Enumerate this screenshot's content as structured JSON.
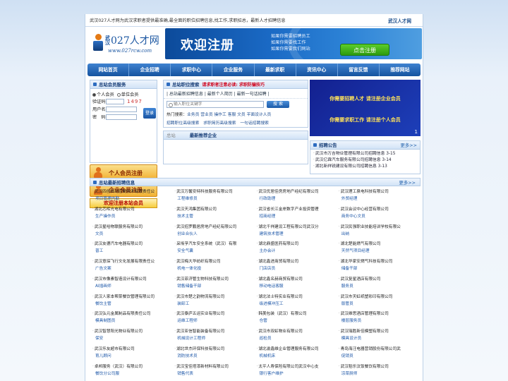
{
  "topbar": {
    "notice": "武汉027人才网为武汉求职者提供最准确,最全面的职位招聘信息,找工作,求职招总，最新人才招聘信息",
    "site_name": "武汉人才网"
  },
  "logo": {
    "city": "武汉",
    "name": "027人才网",
    "url": "www.027rcw.com"
  },
  "banner": {
    "welcome": "欢迎注册",
    "lines": [
      "如果你需要招聘员工",
      "如果你需要找工作",
      "如果你需要我们网站"
    ],
    "button": "点击注册"
  },
  "nav": [
    "网站首页",
    "企业招聘",
    "求职中心",
    "企业服务",
    "最新求职",
    "资讯中心",
    "留言反馈",
    "推荐网站"
  ],
  "login": {
    "title": "总站会员服务",
    "role_personal": "个人会员",
    "role_company": "单位会员",
    "captcha_label": "验证码",
    "captcha_value": "1497",
    "username_label": "用户名",
    "password_label": "密　码",
    "login_button": "登录",
    "personal_register": "个人会员注册",
    "company_register": "企业会员注册",
    "welcome_link": "欢迎注册本站会员"
  },
  "jobsearch": {
    "title": "总站职位搜索",
    "notice": "请求职者注意必读: 求职防骗技巧",
    "tabs": "| 总站最新招聘信息 | 最新个人简历 | 最新一句话招聘 |",
    "placeholder": "输入职位关键字",
    "button": "搜 索",
    "hot_label": "热门搜索：",
    "hot_keywords": "业务员 营业员 操作工 客服 文员 平面设计人员",
    "links": "招聘职位高级搜索　求职简历高级搜索　一句话招聘搜索"
  },
  "recommend": {
    "label1": "总站",
    "title": "最新推荐企业"
  },
  "adbox": {
    "line1": "你需要招聘人才 请注册企业会员",
    "line2": "你需要求职工作 请注册个人会员",
    "page": "1"
  },
  "announcement": {
    "title": "招聘公告",
    "more": "更多>>",
    "items": [
      "武汉市万吉物业管理有限公司招聘信息 3-15",
      "武汉亿霖汽车服务有限公司招聘信息 3-14",
      "湖北新祥锐建设有限公司招聘信息 3-13"
    ]
  },
  "latest": {
    "title": "总站最新招聘信息",
    "more": "更多>>",
    "jobs": [
      {
        "company": "武汉四创自动控制技术有限责任公",
        "position": "项目管理内勤"
      },
      {
        "company": "武汉万馨安特科技服务有限公司",
        "position": "工程维修员"
      },
      {
        "company": "武汉优居佳房房地产经纪有限公司",
        "position": "行政助理"
      },
      {
        "company": "武汉理工泉电科技有限公司",
        "position": "外贸经理"
      },
      {
        "company": "湖北芯晖光电有限公司",
        "position": "生产操作员"
      },
      {
        "company": "武汉天鸿集团有限公司",
        "position": "技术主管"
      },
      {
        "company": "武汉省长江金岸数字产业投资管理",
        "position": "招商经理"
      },
      {
        "company": "武汉会议中心经营有限公司",
        "position": "商务中心文员"
      },
      {
        "company": "武汉星哈物联服务有限公司",
        "position": "文员"
      },
      {
        "company": "武汉招罗鹏居房地产经纪有限公司",
        "position": "创业合伙人"
      },
      {
        "company": "湖北千祥建设工程有限公司武汉分",
        "position": "建筑技术管理"
      },
      {
        "company": "武汉民强职业技能培训学校有限公",
        "position": "出纳"
      },
      {
        "company": "武汉友德汽车电器有限公司",
        "position": "普工"
      },
      {
        "company": "采埃孚汽车安全系统（武汉）有限",
        "position": "安全气囊"
      },
      {
        "company": "湖北鼎盛医药有限公司",
        "position": "主办会计"
      },
      {
        "company": "湖北楚能燃气有限公司",
        "position": "天然气项目经理"
      },
      {
        "company": "武汉意琛飞行文化发展有限责任公",
        "position": "广告文案"
      },
      {
        "company": "武汉梅大华纺织有限公司",
        "position": "机电一体化投"
      },
      {
        "company": "湖北鑫进商贸有限公司",
        "position": "门店店员"
      },
      {
        "company": "湖北华家安燃气科技有限公司",
        "position": "储备干部"
      },
      {
        "company": "武汉市像素智造设计有限公司",
        "position": "AI插画师"
      },
      {
        "company": "武汉菲济管生物科技有限公司",
        "position": "销售储备干部"
      },
      {
        "company": "湖北鑫名赫商贸有限公司",
        "position": "移动电话客服"
      },
      {
        "company": "武汉复星酒店有限公司",
        "position": "服务员"
      },
      {
        "company": "武汉人家本帮菜餐饮管理有限公司",
        "position": "餐饮主管"
      },
      {
        "company": "武汉市楚之韵物流有限公司",
        "position": "装卸工"
      },
      {
        "company": "湖北法士特实业有限公司",
        "position": "级进模冲压工"
      },
      {
        "company": "武汉市天虹纸塑彩印有限公司",
        "position": "版管员"
      },
      {
        "company": "武汉弘元金属制品有限责任公司",
        "position": "模具制图员"
      },
      {
        "company": "武汉泰庐五运实业有限公司",
        "position": "运维工程师"
      },
      {
        "company": "韩美包装（武汉）有限公司",
        "position": "仓管"
      },
      {
        "company": "武汉维思酒店管理有限公司",
        "position": "楼层服务员"
      },
      {
        "company": "武汉智慧阳光物业有限公司",
        "position": "保安"
      },
      {
        "company": "武汉亚信智能装备有限公司",
        "position": "机械设计工程师"
      },
      {
        "company": "武汉市双虹物业有限公司",
        "position": "巡检员"
      },
      {
        "company": "武汉瑞胜新佳模塑有限公司",
        "position": "模具设计员"
      },
      {
        "company": "武汉乐友超市有限公司",
        "position": "育儿顾问"
      },
      {
        "company": "湖北世杰环保科技有限公司",
        "position": "消防技术员"
      },
      {
        "company": "湖北渝鑫维企业管理服务有限公司",
        "position": "机械机床"
      },
      {
        "company": "青岛海汪电器营销股份有限公司武",
        "position": "促销员"
      },
      {
        "company": "卓邦服务（武汉）有限公司",
        "position": "餐饮分公司服"
      },
      {
        "company": "武汉宝佳塔漆新材料有限公司",
        "position": "销售代表"
      },
      {
        "company": "太平人寿保险有限公司武汉中心支",
        "position": "银行客户维护"
      },
      {
        "company": "武汉稻乐汶饭餐饮有限公司",
        "position": "凉菜厨师"
      }
    ]
  }
}
